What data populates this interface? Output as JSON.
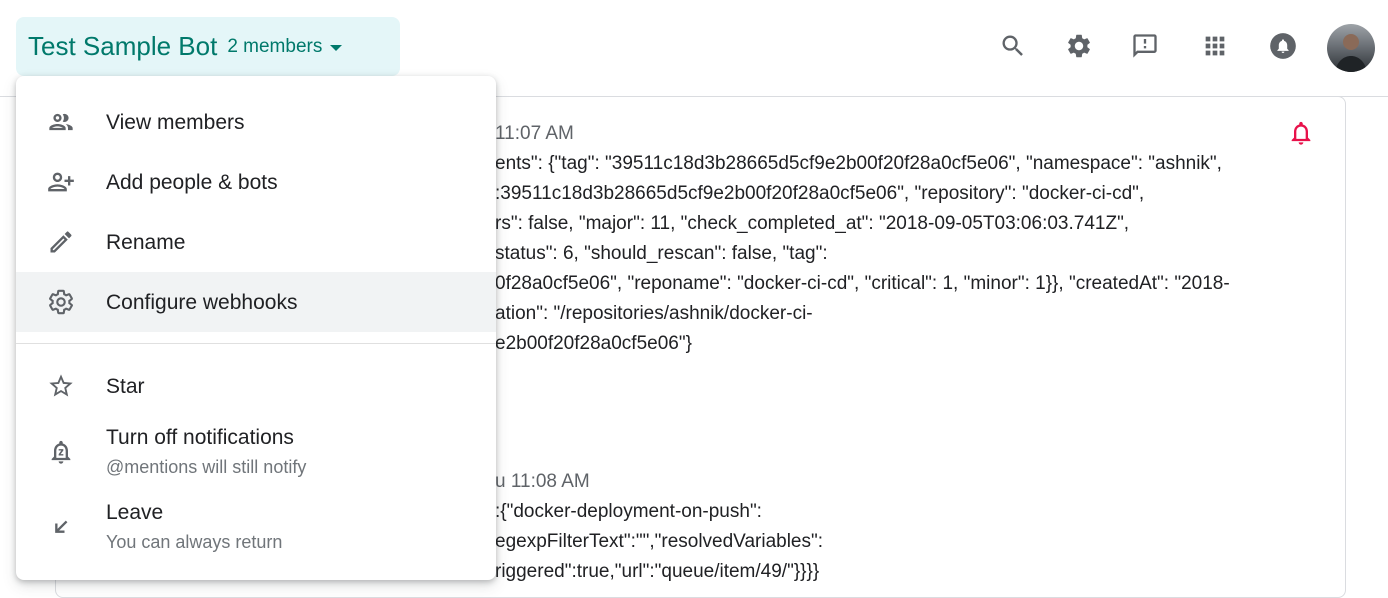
{
  "header": {
    "room_title": "Test Sample Bot",
    "members": "2 members",
    "icons": [
      "search-icon",
      "gear-icon",
      "feedback-icon",
      "apps-grid-icon",
      "notifications-icon"
    ]
  },
  "messages": [
    {
      "time": "11:07 AM",
      "lines": [
        "ents\": {\"tag\": \"39511c18d3b28665d5cf9e2b00f20f28a0cf5e06\", \"namespace\": \"ashnik\",",
        ":39511c18d3b28665d5cf9e2b00f20f28a0cf5e06\", \"repository\": \"docker-ci-cd\",",
        "rs\": false, \"major\": 11, \"check_completed_at\": \"2018-09-05T03:06:03.741Z\",",
        "status\": 6, \"should_rescan\": false, \"tag\":",
        "0f28a0cf5e06\", \"reponame\": \"docker-ci-cd\", \"critical\": 1, \"minor\": 1}}, \"createdAt\": \"2018-",
        "ation\": \"/repositories/ashnik/docker-ci-",
        "e2b00f20f28a0cf5e06\"}"
      ]
    },
    {
      "time": "u 11:08 AM",
      "lines": [
        ":{\"docker-deployment-on-push\":",
        "egexpFilterText\":\"\",\"resolvedVariables\":",
        "riggered\":true,\"url\":\"queue/item/49/\"}}}}"
      ]
    }
  ],
  "menu": {
    "items": [
      {
        "label": "View members",
        "icon": "people-icon"
      },
      {
        "label": "Add people & bots",
        "icon": "add-person-icon"
      },
      {
        "label": "Rename",
        "icon": "pencil-icon"
      },
      {
        "label": "Configure webhooks",
        "icon": "gear-icon"
      },
      {
        "label": "Star",
        "icon": "star-icon"
      },
      {
        "label": "Turn off notifications",
        "sub": "@mentions will still notify",
        "icon": "snooze-bell-icon"
      },
      {
        "label": "Leave",
        "sub": "You can always return",
        "icon": "leave-arrow-icon"
      }
    ]
  },
  "colors": {
    "accent": "#00796b",
    "chip_bg": "#e4f6f8",
    "alert_red": "#e8114a"
  }
}
